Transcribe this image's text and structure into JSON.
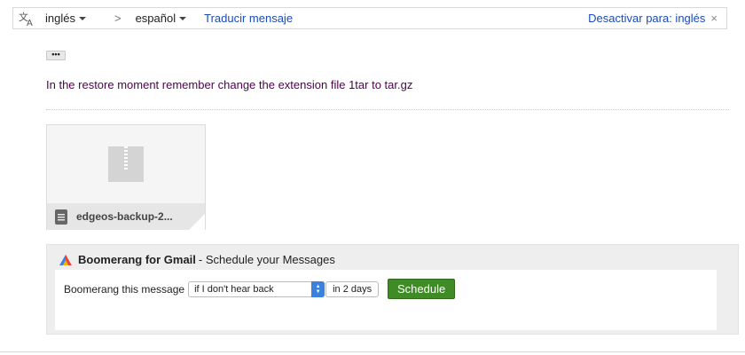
{
  "translate_bar": {
    "source_language": "inglés",
    "target_language": "español",
    "arrow": ">",
    "translate_link": "Traducir mensaje",
    "disable_link": "Desactivar para: inglés",
    "close": "×"
  },
  "message": {
    "trimmed_indicator": "•••",
    "body": "In the restore moment remember change the extension file 1tar to tar.gz"
  },
  "attachment": {
    "filename": "edgeos-backup-2...",
    "preview_icon": "zip-file-icon",
    "type_icon": "document-icon"
  },
  "boomerang": {
    "title": "Boomerang for Gmail",
    "tagline": "- Schedule your Messages",
    "row_label": "Boomerang this message",
    "condition_selected": "if I don't hear back",
    "days_value": "in 2 days",
    "schedule_label": "Schedule",
    "colors": {
      "schedule_button": "#3f8b25",
      "select_arrow": "#3b82e0"
    }
  },
  "colors": {
    "link": "#1a4bb8",
    "message_text": "#500050"
  }
}
